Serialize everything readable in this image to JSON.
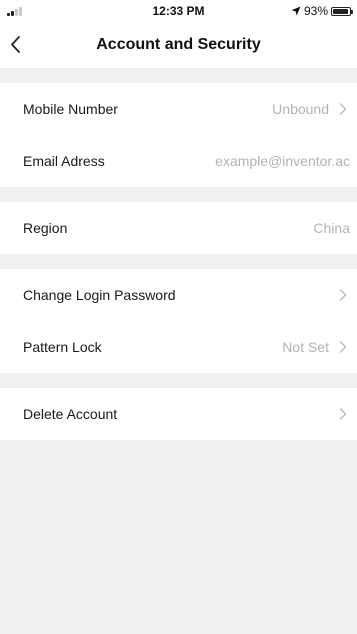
{
  "status_bar": {
    "time": "12:33 PM",
    "battery_text": "93%",
    "battery_level": 0.93
  },
  "nav": {
    "title": "Account and Security"
  },
  "groups": [
    {
      "rows": [
        {
          "label": "Mobile Number",
          "value": "Unbound"
        },
        {
          "label": "Email Adress",
          "value": "example@inventor.ac"
        }
      ]
    },
    {
      "rows": [
        {
          "label": "Region",
          "value": "China"
        }
      ]
    },
    {
      "rows": [
        {
          "label": "Change Login Password",
          "value": ""
        },
        {
          "label": "Pattern Lock",
          "value": "Not Set"
        }
      ]
    },
    {
      "rows": [
        {
          "label": "Delete Account",
          "value": ""
        }
      ]
    }
  ],
  "icons": {
    "back": "chevron-left-icon",
    "chevron": "chevron-right-icon",
    "location": "location-arrow-icon",
    "signal": "signal-strength-icon",
    "battery": "battery-icon"
  },
  "colors": {
    "background": "#f0f0f0",
    "surface": "#ffffff",
    "text": "#1a1a1a",
    "secondary_text": "#b3b3b3"
  }
}
